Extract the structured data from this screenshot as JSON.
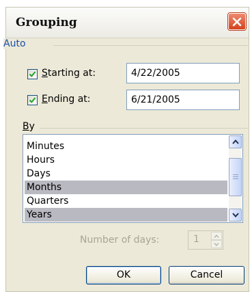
{
  "window": {
    "title": "Grouping",
    "close_icon": "close-icon"
  },
  "auto": {
    "label": "Auto",
    "starting": {
      "checked": true,
      "label_mnemonic": "S",
      "label_rest": "tarting at:",
      "value": "4/22/2005"
    },
    "ending": {
      "checked": true,
      "label_mnemonic": "E",
      "label_rest": "nding at:",
      "value": "6/21/2005"
    }
  },
  "by": {
    "label_mnemonic": "B",
    "label_rest": "y",
    "items": [
      {
        "label": "Minutes",
        "selected": false
      },
      {
        "label": "Hours",
        "selected": false
      },
      {
        "label": "Days",
        "selected": false
      },
      {
        "label": "Months",
        "selected": true
      },
      {
        "label": "Quarters",
        "selected": false
      },
      {
        "label": "Years",
        "selected": true
      }
    ]
  },
  "days": {
    "label": "Number of days:",
    "value": "1",
    "enabled": false
  },
  "buttons": {
    "ok": "OK",
    "cancel": "Cancel"
  },
  "colors": {
    "accent": "#1b4fa8",
    "selection": "#b9b9c2",
    "close": "#d4431d"
  }
}
